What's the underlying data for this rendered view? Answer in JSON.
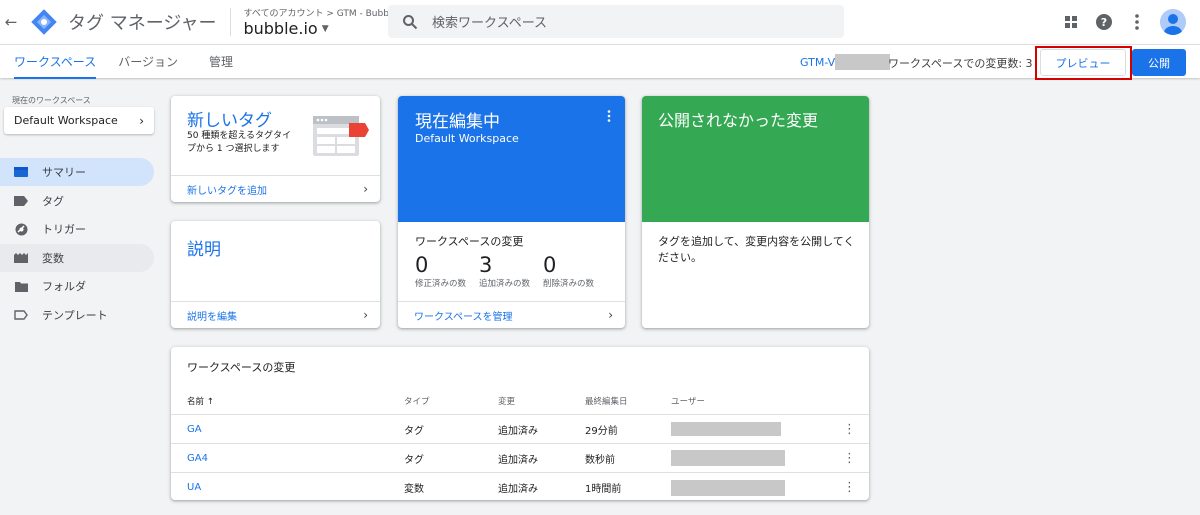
{
  "header": {
    "back_icon": "arrow-left-icon",
    "app_title": "タグ マネージャー",
    "breadcrumb": "すべてのアカウント > GTM - Bubble連携",
    "container_name": "bubble.io",
    "search_placeholder": "検索ワークスペース",
    "icons": [
      "apps-grid-icon",
      "help-icon",
      "more-vert-icon",
      "account-avatar-icon"
    ]
  },
  "tabs": [
    {
      "label": "ワークスペース",
      "active": true
    },
    {
      "label": "バージョン",
      "active": false
    },
    {
      "label": "管理",
      "active": false
    }
  ],
  "toolbar": {
    "gtm_id": "GTM-V",
    "workspace_changes": "ワークスペースでの変更数: 3",
    "preview_label": "プレビュー",
    "publish_label": "公開"
  },
  "sidebar": {
    "workspace_label": "現在のワークスペース",
    "workspace_name": "Default Workspace",
    "items": [
      {
        "label": "サマリー",
        "icon": "summary-icon",
        "state": "active"
      },
      {
        "label": "タグ",
        "icon": "tag-icon",
        "state": ""
      },
      {
        "label": "トリガー",
        "icon": "trigger-icon",
        "state": ""
      },
      {
        "label": "変数",
        "icon": "variables-icon",
        "state": "hover"
      },
      {
        "label": "フォルダ",
        "icon": "folder-icon",
        "state": ""
      },
      {
        "label": "テンプレート",
        "icon": "template-icon",
        "state": ""
      }
    ]
  },
  "cards": {
    "new_tag": {
      "title": "新しいタグ",
      "description": "50 種類を超えるタグタイプから 1 つ選択します",
      "link": "新しいタグを追加"
    },
    "description": {
      "title": "説明",
      "link": "説明を編集"
    },
    "editing": {
      "title": "現在編集中",
      "workspace": "Default Workspace",
      "changes_title": "ワークスペースの変更",
      "stats": [
        {
          "value": "0",
          "label": "修正済みの数"
        },
        {
          "value": "3",
          "label": "追加済みの数"
        },
        {
          "value": "0",
          "label": "削除済みの数"
        }
      ],
      "link": "ワークスペースを管理"
    },
    "unpublished": {
      "title": "公開されなかった変更",
      "text": "タグを追加して、変更内容を公開してください。"
    }
  },
  "changes_table": {
    "title": "ワークスペースの変更",
    "columns": [
      "名前 ↑",
      "タイプ",
      "変更",
      "最終編集日",
      "ユーザー"
    ],
    "rows": [
      {
        "name": "GA",
        "type": "タグ",
        "change": "追加済み",
        "edited": "29分前"
      },
      {
        "name": "GA4",
        "type": "タグ",
        "change": "追加済み",
        "edited": "数秒前"
      },
      {
        "name": "UA",
        "type": "変数",
        "change": "追加済み",
        "edited": "1時間前"
      }
    ]
  },
  "colors": {
    "primary": "#1a73e8",
    "published_green": "#34a853",
    "highlight_red": "#d50000",
    "tag_red": "#ea4335"
  }
}
